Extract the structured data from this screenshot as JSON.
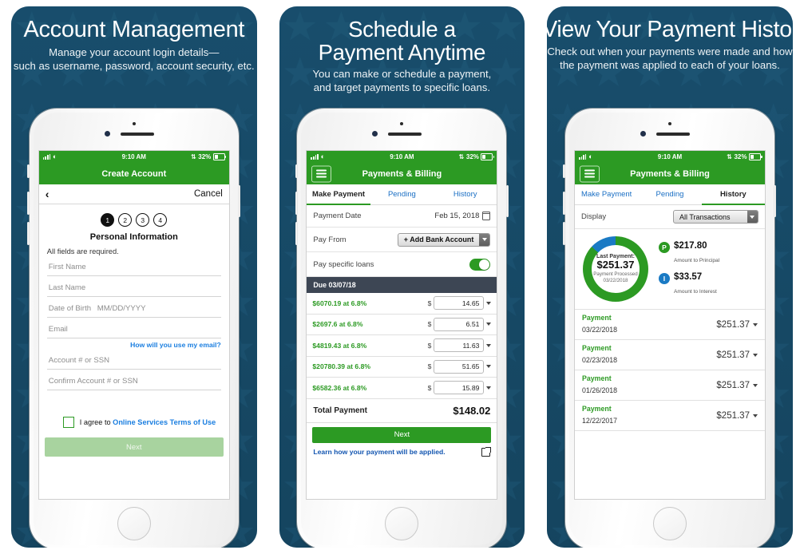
{
  "theme": {
    "card_bg": "#174a68",
    "green": "#2c9a23",
    "blue": "#1a7ac4",
    "link_blue": "#1a7ee0",
    "dark_slate": "#3d4654"
  },
  "panels": [
    {
      "title": "Account Management",
      "subtitle_lines": [
        "Manage your account login details—",
        "such as username, password, account security, etc."
      ],
      "status": {
        "time": "9:10 AM",
        "battery": "32%"
      },
      "navbar": {
        "title": "Create Account"
      },
      "subnav": {
        "back": "‹",
        "cancel": "Cancel"
      },
      "steps": [
        "1",
        "2",
        "3",
        "4"
      ],
      "active_step": 1,
      "form_title": "Personal Information",
      "required_note": "All fields are required.",
      "fields": [
        {
          "label": "First Name"
        },
        {
          "label": "Last Name"
        },
        {
          "label": "Date of Birth",
          "hint": "MM/DD/YYYY"
        },
        {
          "label": "Email"
        },
        {
          "label": "Account # or SSN"
        },
        {
          "label": "Confirm Account # or SSN"
        }
      ],
      "email_link": "How will you use my email?",
      "agree_prefix": "I agree to ",
      "agree_link": "Online Services Terms of Use",
      "next_label": "Next"
    },
    {
      "title_line1": "Schedule a",
      "title_line2": "Payment Anytime",
      "subtitle_lines": [
        "You can make or schedule a payment,",
        "and target payments to specific loans."
      ],
      "status": {
        "time": "9:10 AM",
        "battery": "32%"
      },
      "navbar": {
        "title": "Payments & Billing",
        "menu_icon": "hamburger-icon"
      },
      "tabs": [
        {
          "label": "Make Payment",
          "active": true
        },
        {
          "label": "Pending",
          "active": false
        },
        {
          "label": "History",
          "active": false
        }
      ],
      "payment_date": {
        "label": "Payment Date",
        "value": "Feb 15, 2018"
      },
      "pay_from": {
        "label": "Pay From",
        "value": "+ Add Bank Account"
      },
      "pay_specific": {
        "label": "Pay specific loans",
        "on": true
      },
      "due_bar": "Due 03/07/18",
      "loans": [
        {
          "name": "$6070.19 at 6.8%",
          "amount": "14.65"
        },
        {
          "name": "$2697.6 at 6.8%",
          "amount": "6.51"
        },
        {
          "name": "$4819.43 at 6.8%",
          "amount": "11.63"
        },
        {
          "name": "$20780.39 at 6.8%",
          "amount": "51.65"
        },
        {
          "name": "$6582.36 at 6.8%",
          "amount": "15.89"
        }
      ],
      "currency_symbol": "$",
      "total": {
        "label": "Total Payment",
        "value": "$148.02"
      },
      "next_label": "Next",
      "learn_link": "Learn how your payment will be applied."
    },
    {
      "title": "View Your Payment History",
      "subtitle_lines": [
        "Check out when your payments were made and how",
        "the payment was applied to each of your loans."
      ],
      "status": {
        "time": "9:10 AM",
        "battery": "32%"
      },
      "navbar": {
        "title": "Payments & Billing",
        "menu_icon": "hamburger-icon"
      },
      "tabs": [
        {
          "label": "Make Payment",
          "active": false
        },
        {
          "label": "Pending",
          "active": false
        },
        {
          "label": "History",
          "active": true
        }
      ],
      "display": {
        "label": "Display",
        "value": "All Transactions"
      },
      "donut": {
        "caption": "Last Payment:",
        "amount": "$251.37",
        "status_line1": "Payment Processed",
        "status_line2": "03/22/2018",
        "principal_pct": 87,
        "interest_pct": 13
      },
      "legend": [
        {
          "badge": "P",
          "amount": "$217.80",
          "caption": "Amount to Principal",
          "color": "#2c9a23"
        },
        {
          "badge": "I",
          "amount": "$33.57",
          "caption": "Amount to Interest",
          "color": "#1a7ac4"
        }
      ],
      "payments": [
        {
          "name": "Payment",
          "date": "03/22/2018",
          "amount": "$251.37"
        },
        {
          "name": "Payment",
          "date": "02/23/2018",
          "amount": "$251.37"
        },
        {
          "name": "Payment",
          "date": "01/26/2018",
          "amount": "$251.37"
        },
        {
          "name": "Payment",
          "date": "12/22/2017",
          "amount": "$251.37"
        }
      ]
    }
  ]
}
